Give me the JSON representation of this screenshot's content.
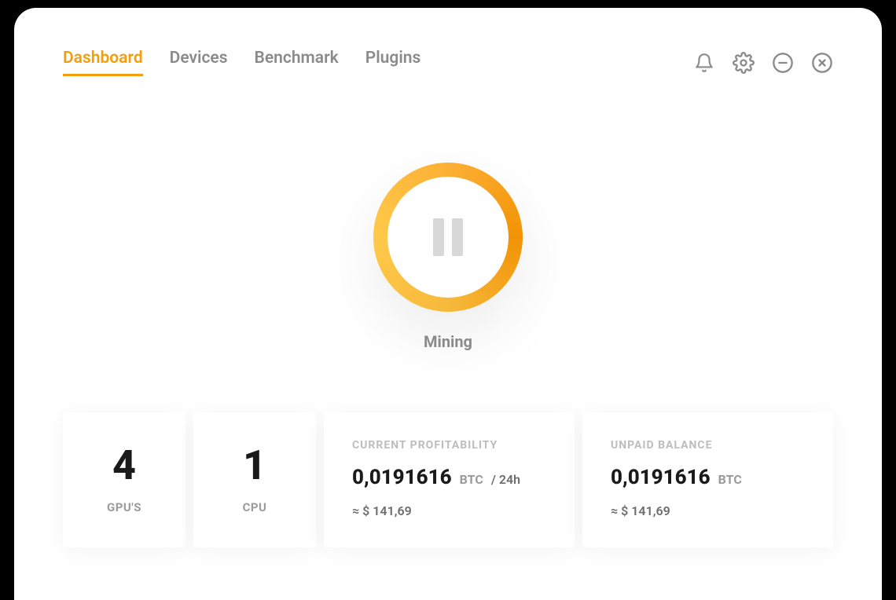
{
  "tabs": {
    "dashboard": "Dashboard",
    "devices": "Devices",
    "benchmark": "Benchmark",
    "plugins": "Plugins"
  },
  "status": {
    "label": "Mining"
  },
  "stats": {
    "gpu": {
      "value": "4",
      "label": "GPU'S"
    },
    "cpu": {
      "value": "1",
      "label": "CPU"
    },
    "profitability": {
      "title": "CURRENT PROFITABILITY",
      "amount": "0,0191616",
      "unit": "BTC",
      "per": "/ 24h",
      "approx": "≈ $ 141,69"
    },
    "balance": {
      "title": "UNPAID BALANCE",
      "amount": "0,0191616",
      "unit": "BTC",
      "approx": "≈ $ 141,69"
    }
  }
}
